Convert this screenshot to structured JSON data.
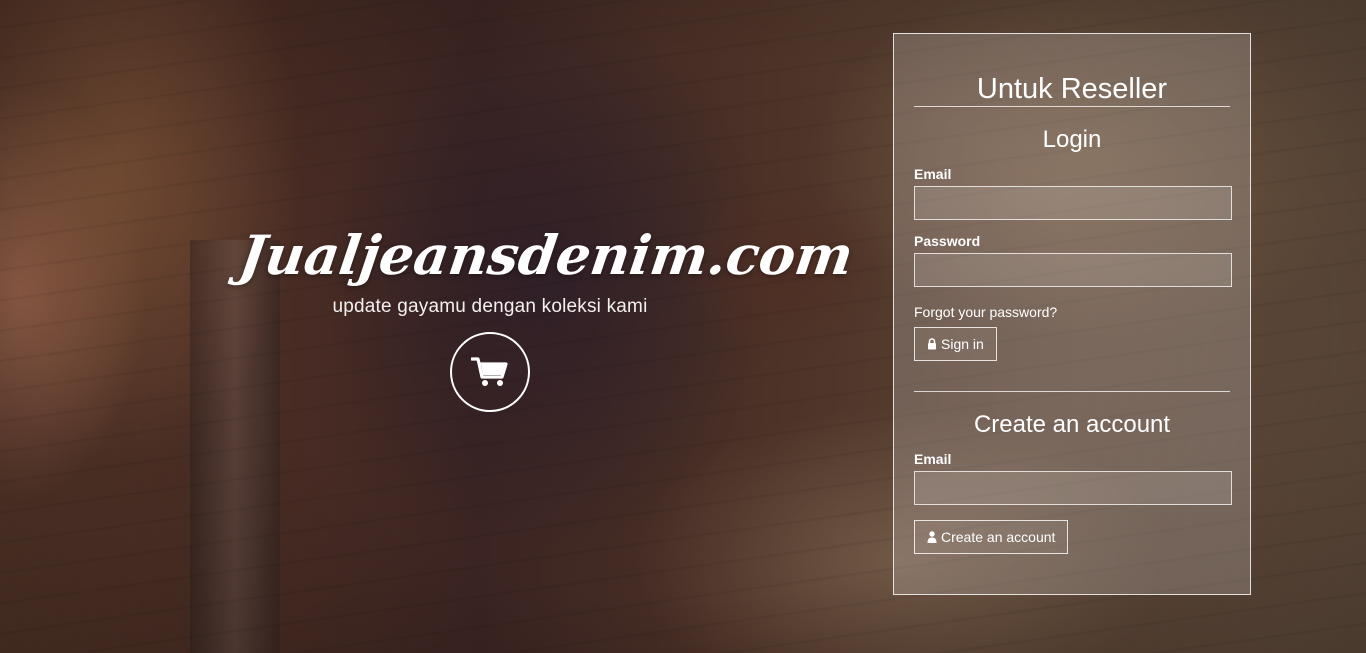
{
  "hero": {
    "brand": "Jualjeansdenim.com",
    "tagline": "update gayamu dengan koleksi kami",
    "cart_icon": "shopping-cart-icon"
  },
  "panel": {
    "title": "Untuk Reseller",
    "login": {
      "heading": "Login",
      "email_label": "Email",
      "email_value": "",
      "password_label": "Password",
      "password_value": "",
      "forgot_link": "Forgot your password?",
      "sign_in_icon": "lock-icon",
      "sign_in_label": "Sign in"
    },
    "create": {
      "heading": "Create an account",
      "email_label": "Email",
      "email_value": "",
      "button_icon": "user-icon",
      "button_label": "Create an account"
    }
  },
  "colors": {
    "text": "#ffffff",
    "panel_border": "#ffffff"
  }
}
